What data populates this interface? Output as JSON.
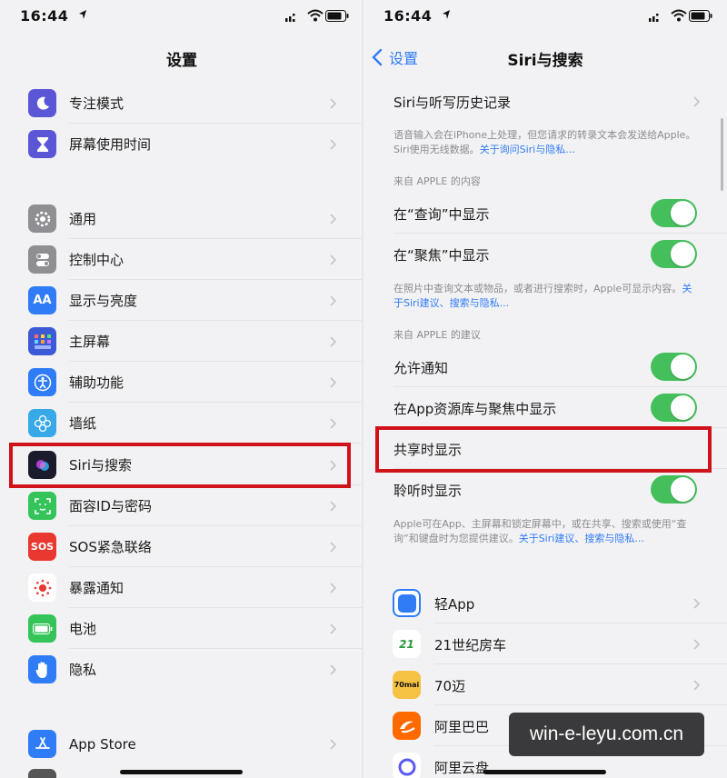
{
  "status": {
    "time": "16:44"
  },
  "left": {
    "title": "设置",
    "group1": [
      {
        "id": "focus",
        "label": "专注模式"
      },
      {
        "id": "screentime",
        "label": "屏幕使用时间"
      }
    ],
    "group2": [
      {
        "id": "general",
        "label": "通用"
      },
      {
        "id": "control",
        "label": "控制中心"
      },
      {
        "id": "display",
        "label": "显示与亮度"
      },
      {
        "id": "home",
        "label": "主屏幕"
      },
      {
        "id": "access",
        "label": "辅助功能"
      },
      {
        "id": "wallpaper",
        "label": "墙纸"
      },
      {
        "id": "siri",
        "label": "Siri与搜索"
      },
      {
        "id": "faceid",
        "label": "面容ID与密码"
      },
      {
        "id": "sos",
        "label": "SOS紧急联络"
      },
      {
        "id": "exposure",
        "label": "暴露通知"
      },
      {
        "id": "battery",
        "label": "电池"
      },
      {
        "id": "privacy",
        "label": "隐私"
      }
    ],
    "group3": [
      {
        "id": "appstore",
        "label": "App Store"
      }
    ],
    "icon_glyphs": {
      "display": "AA",
      "sos": "SOS"
    }
  },
  "right": {
    "back_label": "设置",
    "title": "Siri与搜索",
    "history": "Siri与听写历史记录",
    "note1": {
      "text": "语音输入会在iPhone上处理，但您请求的转录文本会发送给Apple。Siri使用无线数据。",
      "link": "关于询问Siri与隐私..."
    },
    "section1": "来自 APPLE 的内容",
    "toggles1": [
      {
        "label": "在“查询”中显示",
        "on": true
      },
      {
        "label": "在“聚焦”中显示",
        "on": true
      }
    ],
    "note2": {
      "text": "在照片中查询文本或物品，或者进行搜索时，Apple可显示内容。",
      "link": "关于Siri建议、搜索与隐私..."
    },
    "section2": "来自 APPLE 的建议",
    "toggles2": [
      {
        "label": "允许通知",
        "on": true
      },
      {
        "label": "在App资源库与聚焦中显示",
        "on": true
      },
      {
        "label": "共享时显示",
        "on": false
      },
      {
        "label": "聆听时显示",
        "on": true
      }
    ],
    "note3": {
      "text": "Apple可在App、主屏幕和锁定屏幕中，或在共享、搜索或使用“查询”和键盘时为您提供建议。",
      "link": "关于Siri建议、搜索与隐私..."
    },
    "apps": [
      {
        "id": "qing",
        "label": "轻App"
      },
      {
        "id": "fc21",
        "label": "21世纪房车",
        "glyph": "21"
      },
      {
        "id": "m70",
        "label": "70迈",
        "glyph": "70mai"
      },
      {
        "id": "alibaba",
        "label": "阿里巴巴"
      },
      {
        "id": "aliyun",
        "label": "阿里云盘"
      }
    ]
  },
  "watermark": "win-e-leyu.com.cn",
  "colors": {
    "accent": "#2f7cf6",
    "toggle_on": "#44bf5b",
    "highlight": "#d0121b"
  }
}
